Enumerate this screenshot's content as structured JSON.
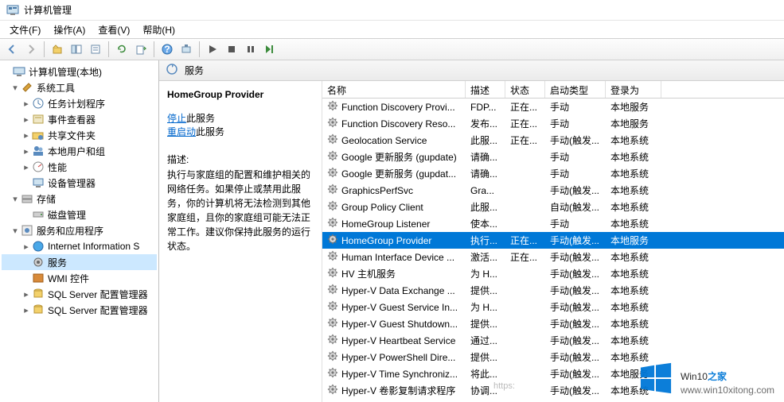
{
  "window": {
    "title": "计算机管理"
  },
  "menu": {
    "file": "文件(F)",
    "action": "操作(A)",
    "view": "查看(V)",
    "help": "帮助(H)"
  },
  "toolbar": {
    "back": "back",
    "forward": "forward",
    "up": "up",
    "show_hide": "show_hide",
    "properties": "properties",
    "export": "export",
    "refresh": "refresh",
    "help": "help",
    "play": "play",
    "stop": "stop",
    "pause": "pause",
    "restart": "restart"
  },
  "tree": {
    "root": "计算机管理(本地)",
    "system_tools": "系统工具",
    "task_scheduler": "任务计划程序",
    "event_viewer": "事件查看器",
    "shared_folders": "共享文件夹",
    "local_users": "本地用户和组",
    "performance": "性能",
    "device_manager": "设备管理器",
    "storage": "存储",
    "disk_mgmt": "磁盘管理",
    "services_apps": "服务和应用程序",
    "iis": "Internet Information S",
    "services": "服务",
    "wmi": "WMI 控件",
    "sql1": "SQL Server 配置管理器",
    "sql2": "SQL Server 配置管理器"
  },
  "panel": {
    "header": "服务"
  },
  "detail": {
    "title": "HomeGroup Provider",
    "stop_link": "停止",
    "stop_suffix": "此服务",
    "restart_link": "重启动",
    "restart_suffix": "此服务",
    "desc_label": "描述:",
    "desc": "执行与家庭组的配置和维护相关的网络任务。如果停止或禁用此服务，你的计算机将无法检测到其他家庭组，且你的家庭组可能无法正常工作。建议你保持此服务的运行状态。"
  },
  "columns": {
    "name": "名称",
    "desc": "描述",
    "status": "状态",
    "startup": "启动类型",
    "logon": "登录为"
  },
  "services": [
    {
      "name": "Function Discovery Provi...",
      "desc": "FDP...",
      "status": "正在...",
      "startup": "手动",
      "logon": "本地服务"
    },
    {
      "name": "Function Discovery Reso...",
      "desc": "发布...",
      "status": "正在...",
      "startup": "手动",
      "logon": "本地服务"
    },
    {
      "name": "Geolocation Service",
      "desc": "此服...",
      "status": "正在...",
      "startup": "手动(触发...",
      "logon": "本地系统"
    },
    {
      "name": "Google 更新服务 (gupdate)",
      "desc": "请确...",
      "status": "",
      "startup": "手动",
      "logon": "本地系统"
    },
    {
      "name": "Google 更新服务 (gupdat...",
      "desc": "请确...",
      "status": "",
      "startup": "手动",
      "logon": "本地系统"
    },
    {
      "name": "GraphicsPerfSvc",
      "desc": "Gra...",
      "status": "",
      "startup": "手动(触发...",
      "logon": "本地系统"
    },
    {
      "name": "Group Policy Client",
      "desc": "此服...",
      "status": "",
      "startup": "自动(触发...",
      "logon": "本地系统"
    },
    {
      "name": "HomeGroup Listener",
      "desc": "使本...",
      "status": "",
      "startup": "手动",
      "logon": "本地系统"
    },
    {
      "name": "HomeGroup Provider",
      "desc": "执行...",
      "status": "正在...",
      "startup": "手动(触发...",
      "logon": "本地服务",
      "selected": true
    },
    {
      "name": "Human Interface Device ...",
      "desc": "激活...",
      "status": "正在...",
      "startup": "手动(触发...",
      "logon": "本地系统"
    },
    {
      "name": "HV 主机服务",
      "desc": "为 H...",
      "status": "",
      "startup": "手动(触发...",
      "logon": "本地系统"
    },
    {
      "name": "Hyper-V Data Exchange ...",
      "desc": "提供...",
      "status": "",
      "startup": "手动(触发...",
      "logon": "本地系统"
    },
    {
      "name": "Hyper-V Guest Service In...",
      "desc": "为 H...",
      "status": "",
      "startup": "手动(触发...",
      "logon": "本地系统"
    },
    {
      "name": "Hyper-V Guest Shutdown...",
      "desc": "提供...",
      "status": "",
      "startup": "手动(触发...",
      "logon": "本地系统"
    },
    {
      "name": "Hyper-V Heartbeat Service",
      "desc": "通过...",
      "status": "",
      "startup": "手动(触发...",
      "logon": "本地系统"
    },
    {
      "name": "Hyper-V PowerShell Dire...",
      "desc": "提供...",
      "status": "",
      "startup": "手动(触发...",
      "logon": "本地系统"
    },
    {
      "name": "Hyper-V Time Synchroniz...",
      "desc": "将此...",
      "status": "",
      "startup": "手动(触发...",
      "logon": "本地服务"
    },
    {
      "name": "Hyper-V 卷影复制请求程序",
      "desc": "协调...",
      "status": "",
      "startup": "手动(触发...",
      "logon": "本地系统"
    }
  ],
  "watermark": {
    "brand_a": "Win10",
    "brand_b": "之家",
    "url_text": "www.win10xitong.com"
  },
  "faint_url": "https:"
}
